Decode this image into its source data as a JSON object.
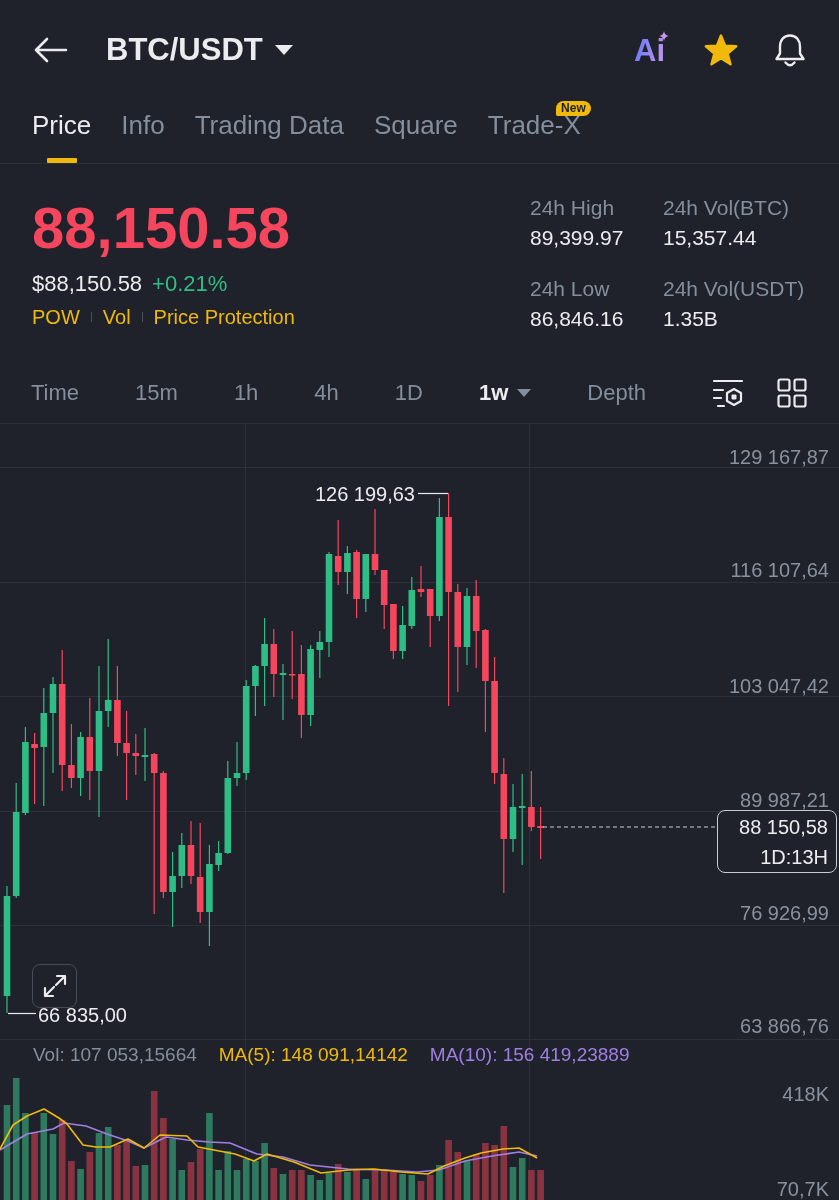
{
  "header": {
    "title": "BTC/USDT",
    "assistant_label": "Ai",
    "favorite": true
  },
  "tabs": [
    {
      "label": "Price",
      "selected": true
    },
    {
      "label": "Info",
      "selected": false
    },
    {
      "label": "Trading Data",
      "selected": false
    },
    {
      "label": "Square",
      "selected": false
    },
    {
      "label": "Trade-X",
      "selected": false,
      "badge": "New"
    }
  ],
  "ticker": {
    "last_price": "88,150.58",
    "last_price_down": true,
    "usd_price": "$88,150.58",
    "change": "+0.21%",
    "change_up": true,
    "tags": [
      "POW",
      "Vol",
      "Price Protection"
    ],
    "stats": [
      {
        "label": "24h High",
        "value": "89,399.97"
      },
      {
        "label": "24h Vol(BTC)",
        "value": "15,357.44"
      },
      {
        "label": "24h Low",
        "value": "86,846.16"
      },
      {
        "label": "24h Vol(USDT)",
        "value": "1.35B"
      }
    ]
  },
  "intervals": [
    {
      "label": "Time",
      "selected": false,
      "has_menu": false
    },
    {
      "label": "15m",
      "selected": false,
      "has_menu": false
    },
    {
      "label": "1h",
      "selected": false,
      "has_menu": false
    },
    {
      "label": "4h",
      "selected": false,
      "has_menu": false
    },
    {
      "label": "1D",
      "selected": false,
      "has_menu": false
    },
    {
      "label": "1w",
      "selected": true,
      "has_menu": true
    },
    {
      "label": "Depth",
      "selected": false,
      "has_menu": false
    }
  ],
  "chart": {
    "price_axis": [
      "129 167,87",
      "116 107,64",
      "103 047,42",
      "89 987,21",
      "76 926,99",
      "63 866,76"
    ],
    "high_label": "126 199,63",
    "low_label": "66 835,00",
    "current_price": "88 150,58",
    "countdown": "1D:13H"
  },
  "volume": {
    "vol": "Vol: 107 053,15664",
    "ma5": "MA(5): 148 091,14142",
    "ma10": "MA(10): 156 419,23889",
    "axis": [
      "418K",
      "70,7K"
    ]
  }
}
